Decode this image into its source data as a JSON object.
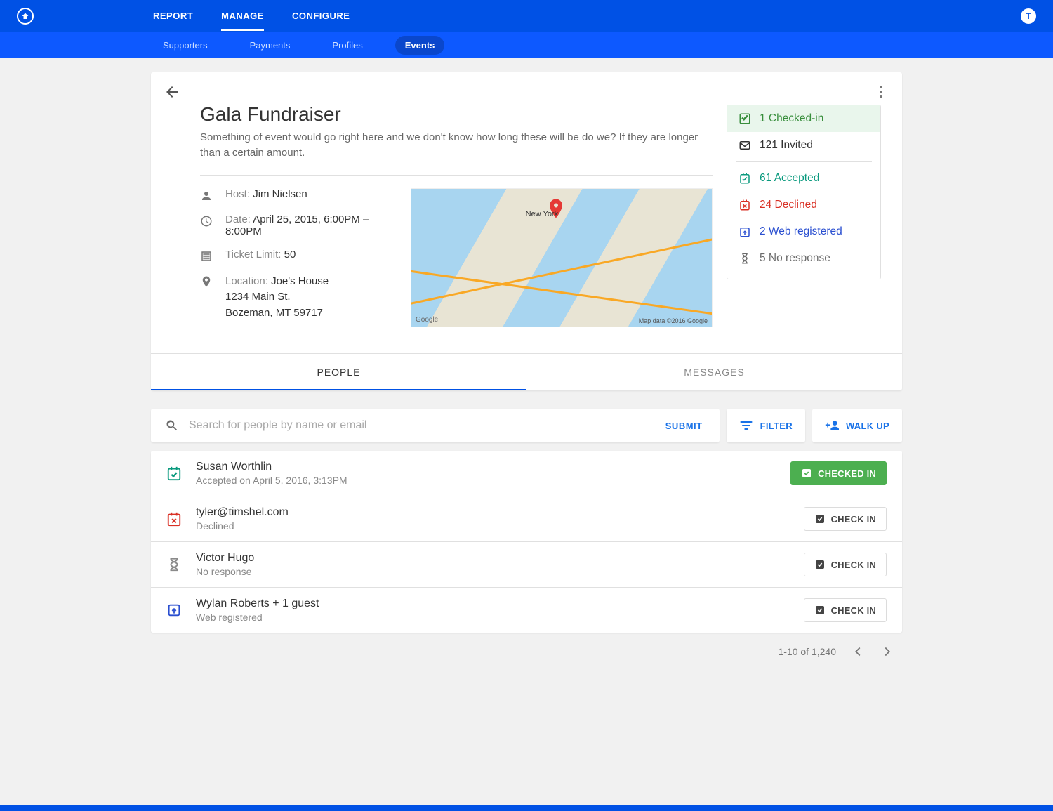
{
  "nav": {
    "primary": [
      "REPORT",
      "MANAGE",
      "CONFIGURE"
    ],
    "primary_active": 1,
    "secondary": [
      "Supporters",
      "Payments",
      "Profiles",
      "Events"
    ],
    "secondary_active": 3,
    "avatar_initial": "T"
  },
  "event": {
    "title": "Gala Fundraiser",
    "description": "Something of event would go right here and we don't know how long these will be do we? If they are longer than a certain amount.",
    "host_label": "Host:",
    "host": "Jim Nielsen",
    "date_label": "Date:",
    "date": "April 25, 2015, 6:00PM – 8:00PM",
    "ticket_limit_label": "Ticket Limit:",
    "ticket_limit": "50",
    "location_label": "Location:",
    "location_name": "Joe's House",
    "location_street": "1234 Main St.",
    "location_city": "Bozeman, MT 59717",
    "map_city_label": "New York",
    "map_brand": "Google",
    "map_attribution": "Map data ©2016 Google"
  },
  "stats": {
    "checked_in": "1 Checked-in",
    "invited": "121 Invited",
    "accepted": "61 Accepted",
    "declined": "24 Declined",
    "web_registered": "2 Web registered",
    "no_response": "5 No response"
  },
  "tabs": {
    "people": "PEOPLE",
    "messages": "MESSAGES",
    "active": "people"
  },
  "search": {
    "placeholder": "Search for people by name or email",
    "submit": "SUBMIT",
    "filter": "FILTER",
    "walk_up": "WALK UP"
  },
  "people": [
    {
      "name": "Susan Worthlin",
      "status": "Accepted on April 5, 2016, 3:13PM",
      "icon": "accepted",
      "button": "CHECKED IN",
      "button_style": "green"
    },
    {
      "name": "tyler@timshel.com",
      "status": "Declined",
      "icon": "declined",
      "button": "CHECK IN",
      "button_style": "default"
    },
    {
      "name": "Victor Hugo",
      "status": "No response",
      "icon": "noresponse",
      "button": "CHECK IN",
      "button_style": "default"
    },
    {
      "name": "Wylan Roberts + 1 guest",
      "status": "Web registered",
      "icon": "webreg",
      "button": "CHECK IN",
      "button_style": "default"
    }
  ],
  "pager": {
    "range": "1-10 of 1,240"
  }
}
